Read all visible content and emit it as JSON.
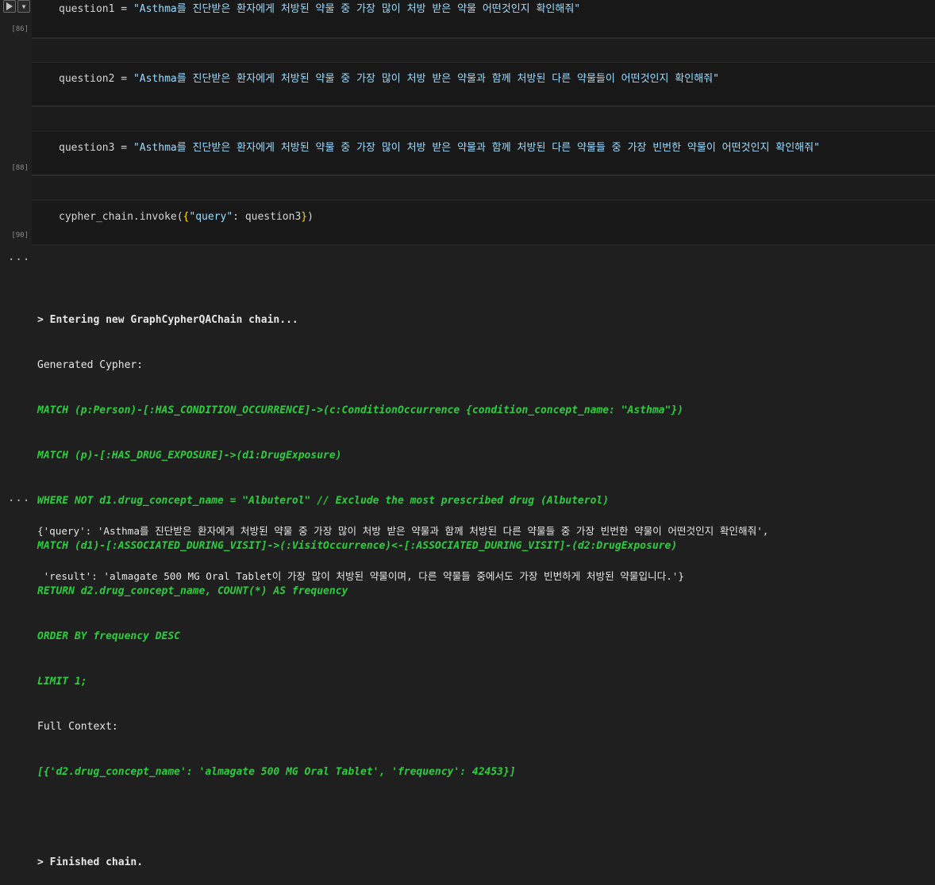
{
  "cells": [
    {
      "exec_count": "[86]",
      "var": "question1",
      "op": " = ",
      "value": "\"Asthma를 진단받은 환자에게 처방된 약물 중 가장 많이 처방 받은 약물 어떤것인지 확인해줘\""
    },
    {
      "exec_count": "",
      "var": "question2",
      "op": " = ",
      "value": "\"Asthma를 진단받은 환자에게 처방된 약물 중 가장 많이 처방 받은 약물과 함께 처방된 다른 약물들이 어떤것인지 확인해줘\""
    },
    {
      "exec_count": "[88]",
      "var": "question3",
      "op": " = ",
      "value": "\"Asthma를 진단받은 환자에게 처방된 약물 중 가장 많이 처방 받은 약물과 함께 처방된 다른 약물들 중 가장 빈번한 약물이 어떤것인지 확인해줘\""
    },
    {
      "exec_count": "[90]",
      "call_prefix": "cypher_chain.invoke(",
      "brace_open": "{",
      "key": "\"query\"",
      "sep": ": question3",
      "brace_close": "}",
      "call_suffix": ")"
    }
  ],
  "output": {
    "ellipsis_1": "...",
    "ellipsis_2": "...",
    "entering": "> Entering new GraphCypherQAChain chain...",
    "generated_label": "Generated Cypher:",
    "cypher_lines": [
      "MATCH (p:Person)-[:HAS_CONDITION_OCCURRENCE]->(c:ConditionOccurrence {condition_concept_name: \"Asthma\"})",
      "MATCH (p)-[:HAS_DRUG_EXPOSURE]->(d1:DrugExposure)",
      "WHERE NOT d1.drug_concept_name = \"Albuterol\" // Exclude the most prescribed drug (Albuterol)",
      "MATCH (d1)-[:ASSOCIATED_DURING_VISIT]->(:VisitOccurrence)<-[:ASSOCIATED_DURING_VISIT]-(d2:DrugExposure)",
      "RETURN d2.drug_concept_name, COUNT(*) AS frequency",
      "ORDER BY frequency DESC",
      "LIMIT 1;"
    ],
    "full_context_label": "Full Context:",
    "full_context_value": "[{'d2.drug_concept_name': 'almagate 500 MG Oral Tablet', 'frequency': 42453}]",
    "finished": "> Finished chain.",
    "result_line1": "{'query': 'Asthma를 진단받은 환자에게 처방된 약물 중 가장 많이 처방 받은 약물과 함께 처방된 다른 약물들 중 가장 빈번한 약물이 어떤것인지 확인해줘',",
    "result_line2": " 'result': 'almagate 500 MG Oral Tablet이 가장 많이 처방된 약물이며, 다른 약물들 중에서도 가장 빈번하게 처방된 약물입니다.'}"
  }
}
